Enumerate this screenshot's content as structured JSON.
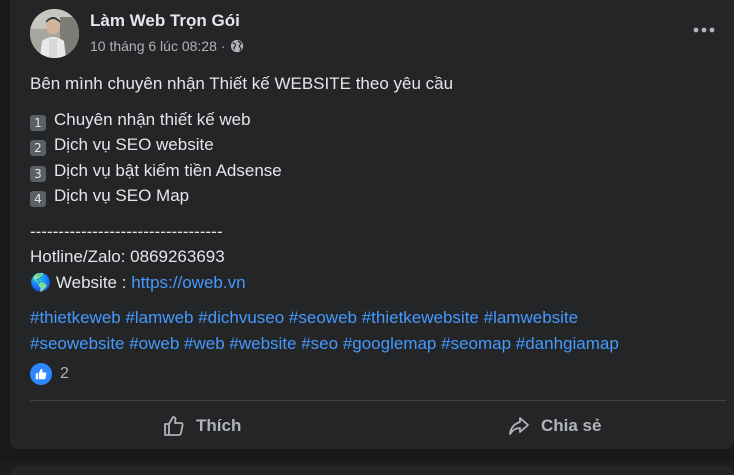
{
  "post": {
    "author": "Làm Web Trọn Gói",
    "timestamp": "10 tháng 6 lúc 08:28",
    "separator": "·",
    "privacy_icon": "globe-icon",
    "intro": "Bên mình chuyên nhận Thiết kế WEBSITE theo yêu cầu",
    "services": [
      {
        "num": "1",
        "text": "Chuyên nhận thiết kế web"
      },
      {
        "num": "2",
        "text": "Dịch vụ SEO website"
      },
      {
        "num": "3",
        "text": "Dịch vụ bật kiếm tiền Adsense"
      },
      {
        "num": "4",
        "text": "Dịch vụ SEO Map"
      }
    ],
    "dashes": "----------------------------------",
    "hotline": "Hotline/Zalo: 0869263693",
    "website_emoji": "🌎",
    "website_label": "Website : ",
    "website_url": "https://oweb.vn",
    "hashtags_line1": "#thietkeweb #lamweb #dichvuseo #seoweb #thietkewebsite #lamwebsite",
    "hashtags_line2": "#seowebsite #oweb #web #website #seo #googlemap #seomap #danhgiamap",
    "reaction_count": "2"
  },
  "actions": {
    "like_label": "Thích",
    "share_label": "Chia sẻ"
  },
  "colors": {
    "background": "#18191a",
    "card": "#242526",
    "text": "#e4e6eb",
    "secondary": "#b0b3b8",
    "link": "#4599ff",
    "like_blue": "#2d88ff"
  }
}
